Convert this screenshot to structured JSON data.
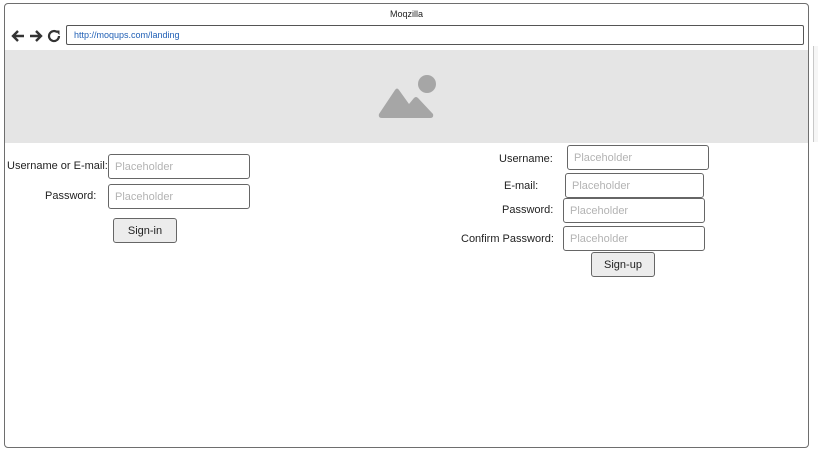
{
  "window": {
    "title": "Moqzilla",
    "url": "http://moqups.com/landing"
  },
  "nav": {
    "back_icon": "arrow-left-icon",
    "forward_icon": "arrow-right-icon",
    "reload_icon": "reload-icon"
  },
  "hero": {
    "image_icon": "image-placeholder-icon",
    "background_color": "#e5e5e5"
  },
  "signin": {
    "username_label": "Username or E-mail:",
    "username_placeholder": "Placeholder",
    "password_label": "Password:",
    "password_placeholder": "Placeholder",
    "button_label": "Sign-in"
  },
  "signup": {
    "username_label": "Username:",
    "username_placeholder": "Placeholder",
    "email_label": "E-mail:",
    "email_placeholder": "Placeholder",
    "password_label": "Password:",
    "password_placeholder": "Placeholder",
    "confirm_label": "Confirm Password:",
    "confirm_placeholder": "Placeholder",
    "button_label": "Sign-up"
  }
}
